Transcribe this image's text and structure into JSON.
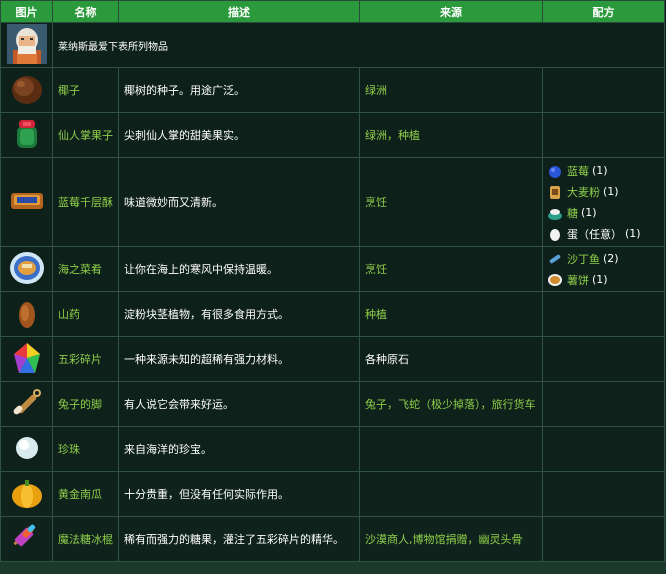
{
  "headers": {
    "image": "图片",
    "name": "名称",
    "desc": "描述",
    "source": "来源",
    "recipe": "配方"
  },
  "intro": {
    "text": "莱纳斯最爱下表所列物品"
  },
  "rows": [
    {
      "name": "椰子",
      "desc": "椰树的种子。用途广泛。",
      "sources": [
        {
          "text": "绿洲"
        }
      ]
    },
    {
      "name": "仙人掌果子",
      "desc": "尖刺仙人掌的甜美果实。",
      "sources": [
        {
          "text": "绿洲，种植"
        }
      ]
    },
    {
      "name": "蓝莓千层酥",
      "desc": "味道微妙而又清新。",
      "sources": [
        {
          "text": "烹饪"
        }
      ],
      "recipe": [
        {
          "label": "蓝莓",
          "qty": "(1)"
        },
        {
          "label": "大麦粉",
          "qty": "(1)"
        },
        {
          "label": "糖",
          "qty": "(1)"
        },
        {
          "label": "蛋（任意）",
          "qty": "(1)",
          "plain": true
        }
      ]
    },
    {
      "name": "海之菜肴",
      "desc": "让你在海上的寒风中保持温暖。",
      "sources": [
        {
          "text": "烹饪"
        }
      ],
      "recipe": [
        {
          "label": "沙丁鱼",
          "qty": "(2)"
        },
        {
          "label": "薯饼",
          "qty": "(1)"
        }
      ]
    },
    {
      "name": "山药",
      "desc": "淀粉块茎植物，有很多食用方式。",
      "sources": [
        {
          "text": "种植"
        }
      ]
    },
    {
      "name": "五彩碎片",
      "desc": "一种来源未知的超稀有强力材料。",
      "sources": [
        {
          "text": "各种原石",
          "plain": true
        }
      ]
    },
    {
      "name": "兔子的脚",
      "desc": "有人说它会带来好运。",
      "sources": [
        {
          "text": "兔子，飞蛇（极少掉落），旅行货车"
        }
      ]
    },
    {
      "name": "珍珠",
      "desc": "来自海洋的珍宝。",
      "sources": []
    },
    {
      "name": "黄金南瓜",
      "desc": "十分贵重，但没有任何实际作用。",
      "sources": []
    },
    {
      "name": "魔法糖冰棍",
      "desc": "稀有而强力的糖果，灌注了五彩碎片的精华。",
      "sources": [
        {
          "text": "沙漠商人,博物馆捐赠，幽灵头骨"
        }
      ]
    }
  ],
  "colors": {
    "header_bg": "#2b9a3c",
    "link": "#8fce4a",
    "cell_bg": "#0e201a"
  }
}
